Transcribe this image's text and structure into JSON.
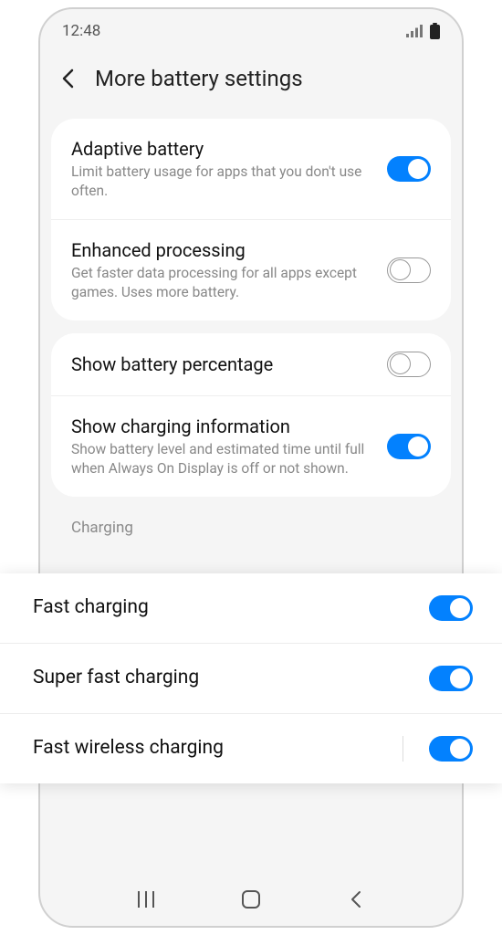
{
  "status": {
    "time": "12:48"
  },
  "header": {
    "title": "More battery settings"
  },
  "group1": {
    "adaptive": {
      "title": "Adaptive battery",
      "desc": "Limit battery usage for apps that you don't use often."
    },
    "enhanced": {
      "title": "Enhanced processing",
      "desc": "Get faster data processing for all apps except games. Uses more battery."
    }
  },
  "group2": {
    "percentage": {
      "title": "Show battery percentage"
    },
    "charginginfo": {
      "title": "Show charging information",
      "desc": "Show battery level and estimated time until full when Always On Display is off or not shown."
    }
  },
  "section": {
    "charging": "Charging"
  },
  "charging": {
    "fast": {
      "title": "Fast charging"
    },
    "superfast": {
      "title": "Super fast charging"
    },
    "wireless": {
      "title": "Fast wireless charging"
    }
  }
}
